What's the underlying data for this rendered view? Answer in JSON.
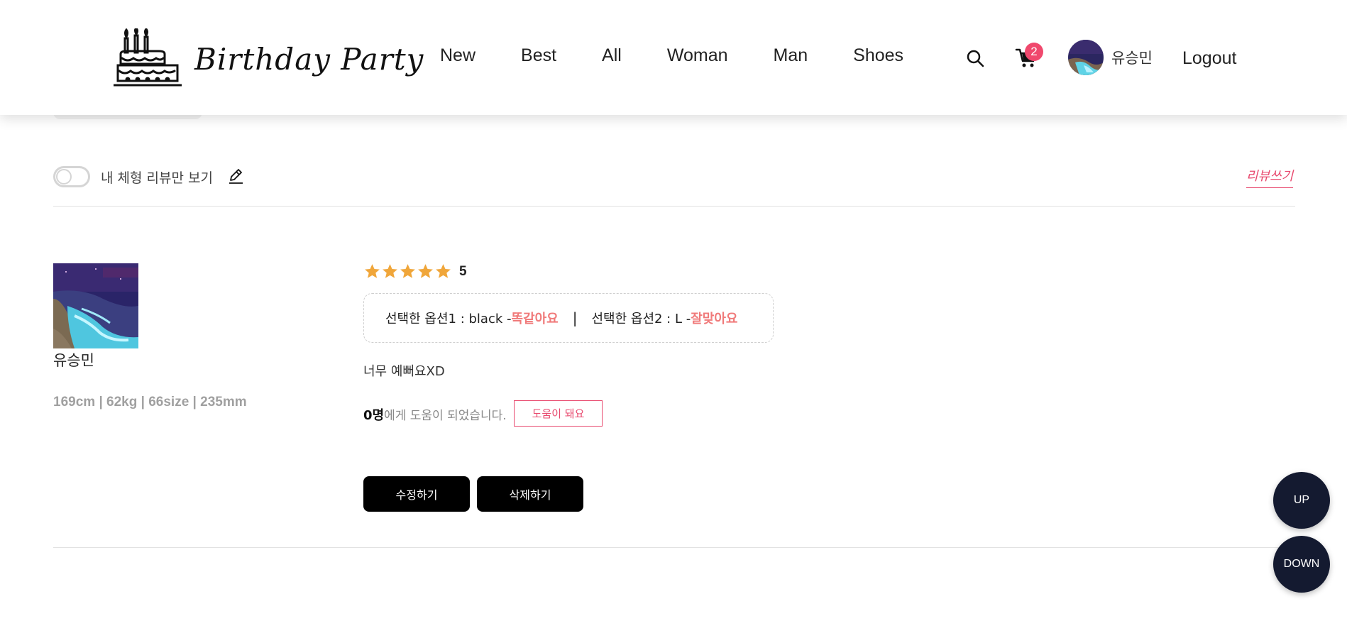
{
  "header": {
    "brand": "Birthday Party",
    "nav": [
      "New",
      "Best",
      "All",
      "Woman",
      "Man",
      "Shoes"
    ],
    "cart_count": "2",
    "user_name": "유승민",
    "logout_label": "Logout"
  },
  "filter": {
    "toggle_label": "내 체형 리뷰만 보기",
    "write_review_label": "리뷰쓰기"
  },
  "review": {
    "reviewer_name": "유승민",
    "body_info": "169cm | 62kg | 66size | 235mm",
    "rating": "5",
    "option1_label": "선택한 옵션1 : black - ",
    "option1_value": "똑같아요",
    "separator": "|",
    "option2_label": "선택한 옵션2 : L - ",
    "option2_value": "잘맞아요",
    "text": "너무 예뻐요XD",
    "helpful_count": "0명",
    "helpful_suffix": "에게 도움이 되었습니다.",
    "helpful_button": "도움이 돼요",
    "edit_button": "수정하기",
    "delete_button": "삭제하기"
  },
  "floating": {
    "up_label": "UP",
    "down_label": "DOWN"
  },
  "colors": {
    "accent_pink": "#e8496e",
    "option_value": "#f07a7a",
    "star": "#f0a63a",
    "float_bg": "#141a30"
  },
  "icons": [
    "cake-logo-icon",
    "search-icon",
    "cart-icon",
    "pencil-icon",
    "star-icon"
  ]
}
